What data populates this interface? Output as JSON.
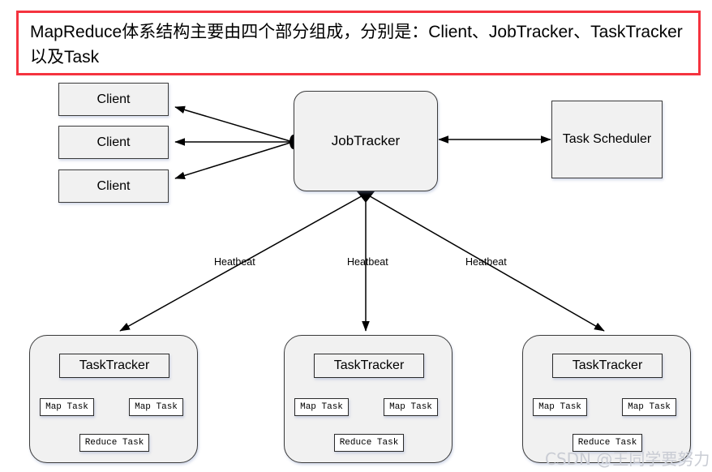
{
  "header": {
    "text": "MapReduce体系结构主要由四个部分组成，分别是：Client、JobTracker、TaskTracker以及Task",
    "border_color": "#f5333f"
  },
  "nodes": {
    "clients": [
      {
        "label": "Client"
      },
      {
        "label": "Client"
      },
      {
        "label": "Client"
      }
    ],
    "jobtracker": {
      "label": "JobTracker"
    },
    "task_scheduler": {
      "label": "Task Scheduler"
    }
  },
  "clusters": [
    {
      "title": "TaskTracker",
      "map_tasks": [
        "Map Task",
        "Map Task"
      ],
      "reduce_task": "Reduce Task"
    },
    {
      "title": "TaskTracker",
      "map_tasks": [
        "Map Task",
        "Map Task"
      ],
      "reduce_task": "Reduce Task"
    },
    {
      "title": "TaskTracker",
      "map_tasks": [
        "Map Task",
        "Map Task"
      ],
      "reduce_task": "Reduce Task"
    }
  ],
  "edge_labels": {
    "heartbeat_1": "Heatbeat",
    "heartbeat_2": "Heatbeat",
    "heartbeat_3": "Heatbeat"
  },
  "watermark": {
    "text": "CSDN @王同学要努力"
  },
  "colors": {
    "node_fill": "#f1f1f1",
    "task_fill": "#ffffff",
    "stroke": "#3b3b3b",
    "accent_red": "#f5333f",
    "watermark": "#c9ccd4"
  }
}
